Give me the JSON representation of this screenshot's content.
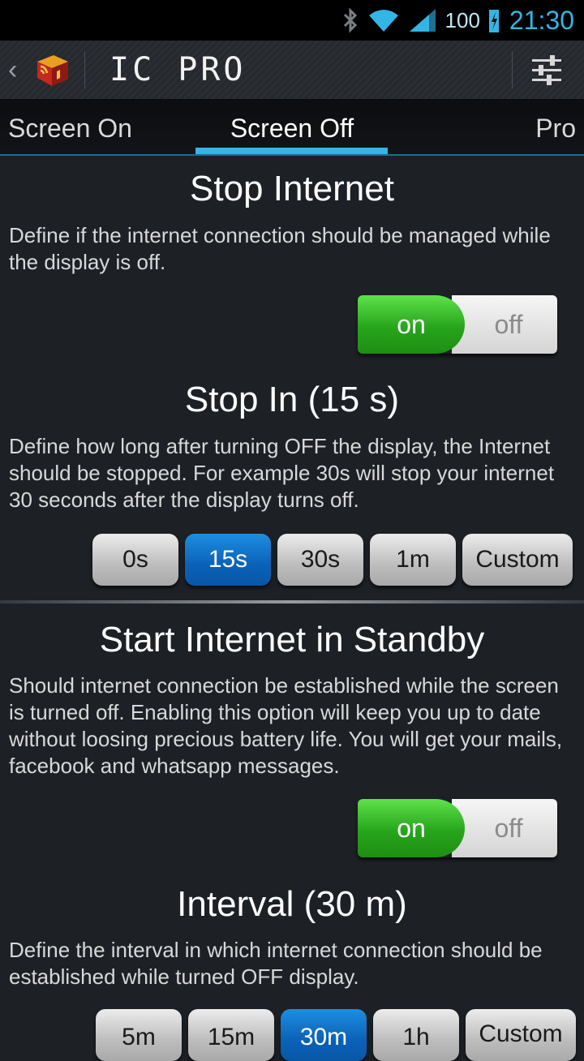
{
  "status_bar": {
    "battery": "100",
    "time": "21:30"
  },
  "action_bar": {
    "title": "IC PRO"
  },
  "tabs": {
    "left": "Screen On",
    "center": "Screen Off",
    "right": "Pro"
  },
  "stop_internet": {
    "title": "Stop Internet",
    "description": "Define if the internet connection should be managed while the display is off.",
    "toggle_on": "on",
    "toggle_off": "off"
  },
  "stop_in": {
    "title": "Stop In (15 s)",
    "description": "Define how long after turning OFF the display, the Internet should be stopped. For example 30s will stop your internet 30 seconds after the display turns off.",
    "options": [
      "0s",
      "15s",
      "30s",
      "1m",
      "Custom"
    ],
    "selected": "15s"
  },
  "standby": {
    "title": "Start Internet in Standby",
    "description": "Should internet connection be established while the screen is turned off. Enabling this option will keep you up to date without loosing precious battery life. You will get your mails, facebook and whatsapp messages.",
    "toggle_on": "on",
    "toggle_off": "off"
  },
  "interval": {
    "title": "Interval (30 m)",
    "description": "Define the interval in which internet connection should be established while turned OFF display.",
    "options": [
      "5m",
      "15m",
      "30m",
      "1h",
      "Custom"
    ],
    "selected": "30m"
  },
  "colors": {
    "accent": "#33b5e5",
    "toggle_on": "#27a51b",
    "segment_active": "#0a62b8"
  }
}
